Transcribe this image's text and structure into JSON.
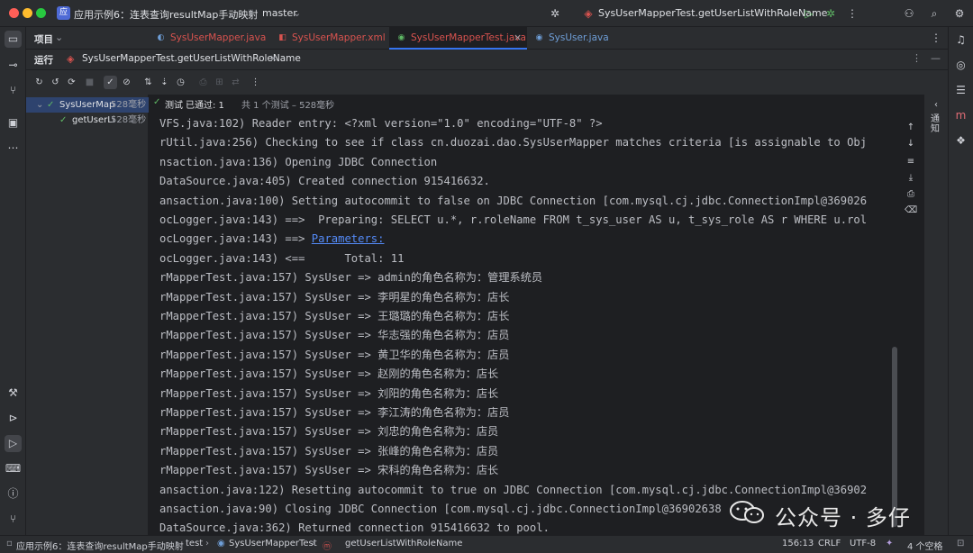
{
  "titlebar": {
    "project_badge": "应",
    "project_name": "应用示例6：连表查询resultMap手动映射",
    "branch": "master",
    "run_config": "SysUserMapperTest.getUserListWithRoleName"
  },
  "project_panel": {
    "title": "项目"
  },
  "editor_tabs": [
    {
      "label": "SysUserMapper.java",
      "icon": "mapper-interface-icon"
    },
    {
      "label": "SysUserMapper.xml",
      "icon": "xml-file-icon"
    },
    {
      "label": "SysUserMapperTest.java",
      "icon": "test-class-icon"
    },
    {
      "label": "SysUser.java",
      "icon": "class-icon"
    }
  ],
  "run_window": {
    "title": "运行",
    "tab_label": "SysUserMapperTest.getUserListWithRoleName"
  },
  "test_tree": [
    {
      "name": "SysUserMap",
      "time": "528毫秒"
    },
    {
      "name": "getUserLi",
      "time": "528毫秒"
    }
  ],
  "test_status": {
    "prefix": "测试",
    "passed": "已通过: 1",
    "detail": "共 1 个测试 – 528毫秒"
  },
  "console_lines": [
    "VFS.java:102) Reader entry: <?xml version=\"1.0\" encoding=\"UTF-8\" ?>",
    "rUtil.java:256) Checking to see if class cn.duozai.dao.SysUserMapper matches criteria [is assignable to Obj",
    "nsaction.java:136) Opening JDBC Connection",
    "DataSource.java:405) Created connection 915416632.",
    "ansaction.java:100) Setting autocommit to false on JDBC Connection [com.mysql.cj.jdbc.ConnectionImpl@369026",
    "ocLogger.java:143) ==>  Preparing: SELECT u.*, r.roleName FROM t_sys_user AS u, t_sys_role AS r WHERE u.rol",
    "ocLogger.java:143) ==> ",
    "ocLogger.java:143) <==      Total: 11",
    "rMapperTest.java:157) SysUser => admin的角色名称为：管理系统员",
    "rMapperTest.java:157) SysUser => 李明星的角色名称为：店长",
    "rMapperTest.java:157) SysUser => 王璐璐的角色名称为：店长",
    "rMapperTest.java:157) SysUser => 华志强的角色名称为：店员",
    "rMapperTest.java:157) SysUser => 黄卫华的角色名称为：店员",
    "rMapperTest.java:157) SysUser => 赵刚的角色名称为：店长",
    "rMapperTest.java:157) SysUser => 刘阳的角色名称为：店长",
    "rMapperTest.java:157) SysUser => 李江涛的角色名称为：店员",
    "rMapperTest.java:157) SysUser => 刘忠的角色名称为：店员",
    "rMapperTest.java:157) SysUser => 张峰的角色名称为：店员",
    "rMapperTest.java:157) SysUser => 宋科的角色名称为：店长",
    "ansaction.java:122) Resetting autocommit to true on JDBC Connection [com.mysql.cj.jdbc.ConnectionImpl@36902",
    "ansaction.java:90) Closing JDBC Connection [com.mysql.cj.jdbc.ConnectionImpl@36902638",
    "DataSource.java:362) Returned connection 915416632 to pool."
  ],
  "console_link": "Parameters:",
  "side_panel_label": "通知",
  "statusbar": {
    "breadcrumb": [
      "应用示例6：连表查询resultMap手动映射",
      "test",
      "SysUserMapperTest",
      "getUserListWithRoleName"
    ],
    "position": "156:13",
    "line_ending": "CRLF",
    "encoding": "UTF-8",
    "indent": "4 个空格"
  },
  "watermark": {
    "text": "公众号 · 多仔"
  },
  "colors": {
    "accent": "#3574f0",
    "success": "#5fb865",
    "link": "#548af7",
    "close_red": "#ff5f57",
    "minimize_yellow": "#febc2e",
    "maximize_green": "#28c840"
  }
}
